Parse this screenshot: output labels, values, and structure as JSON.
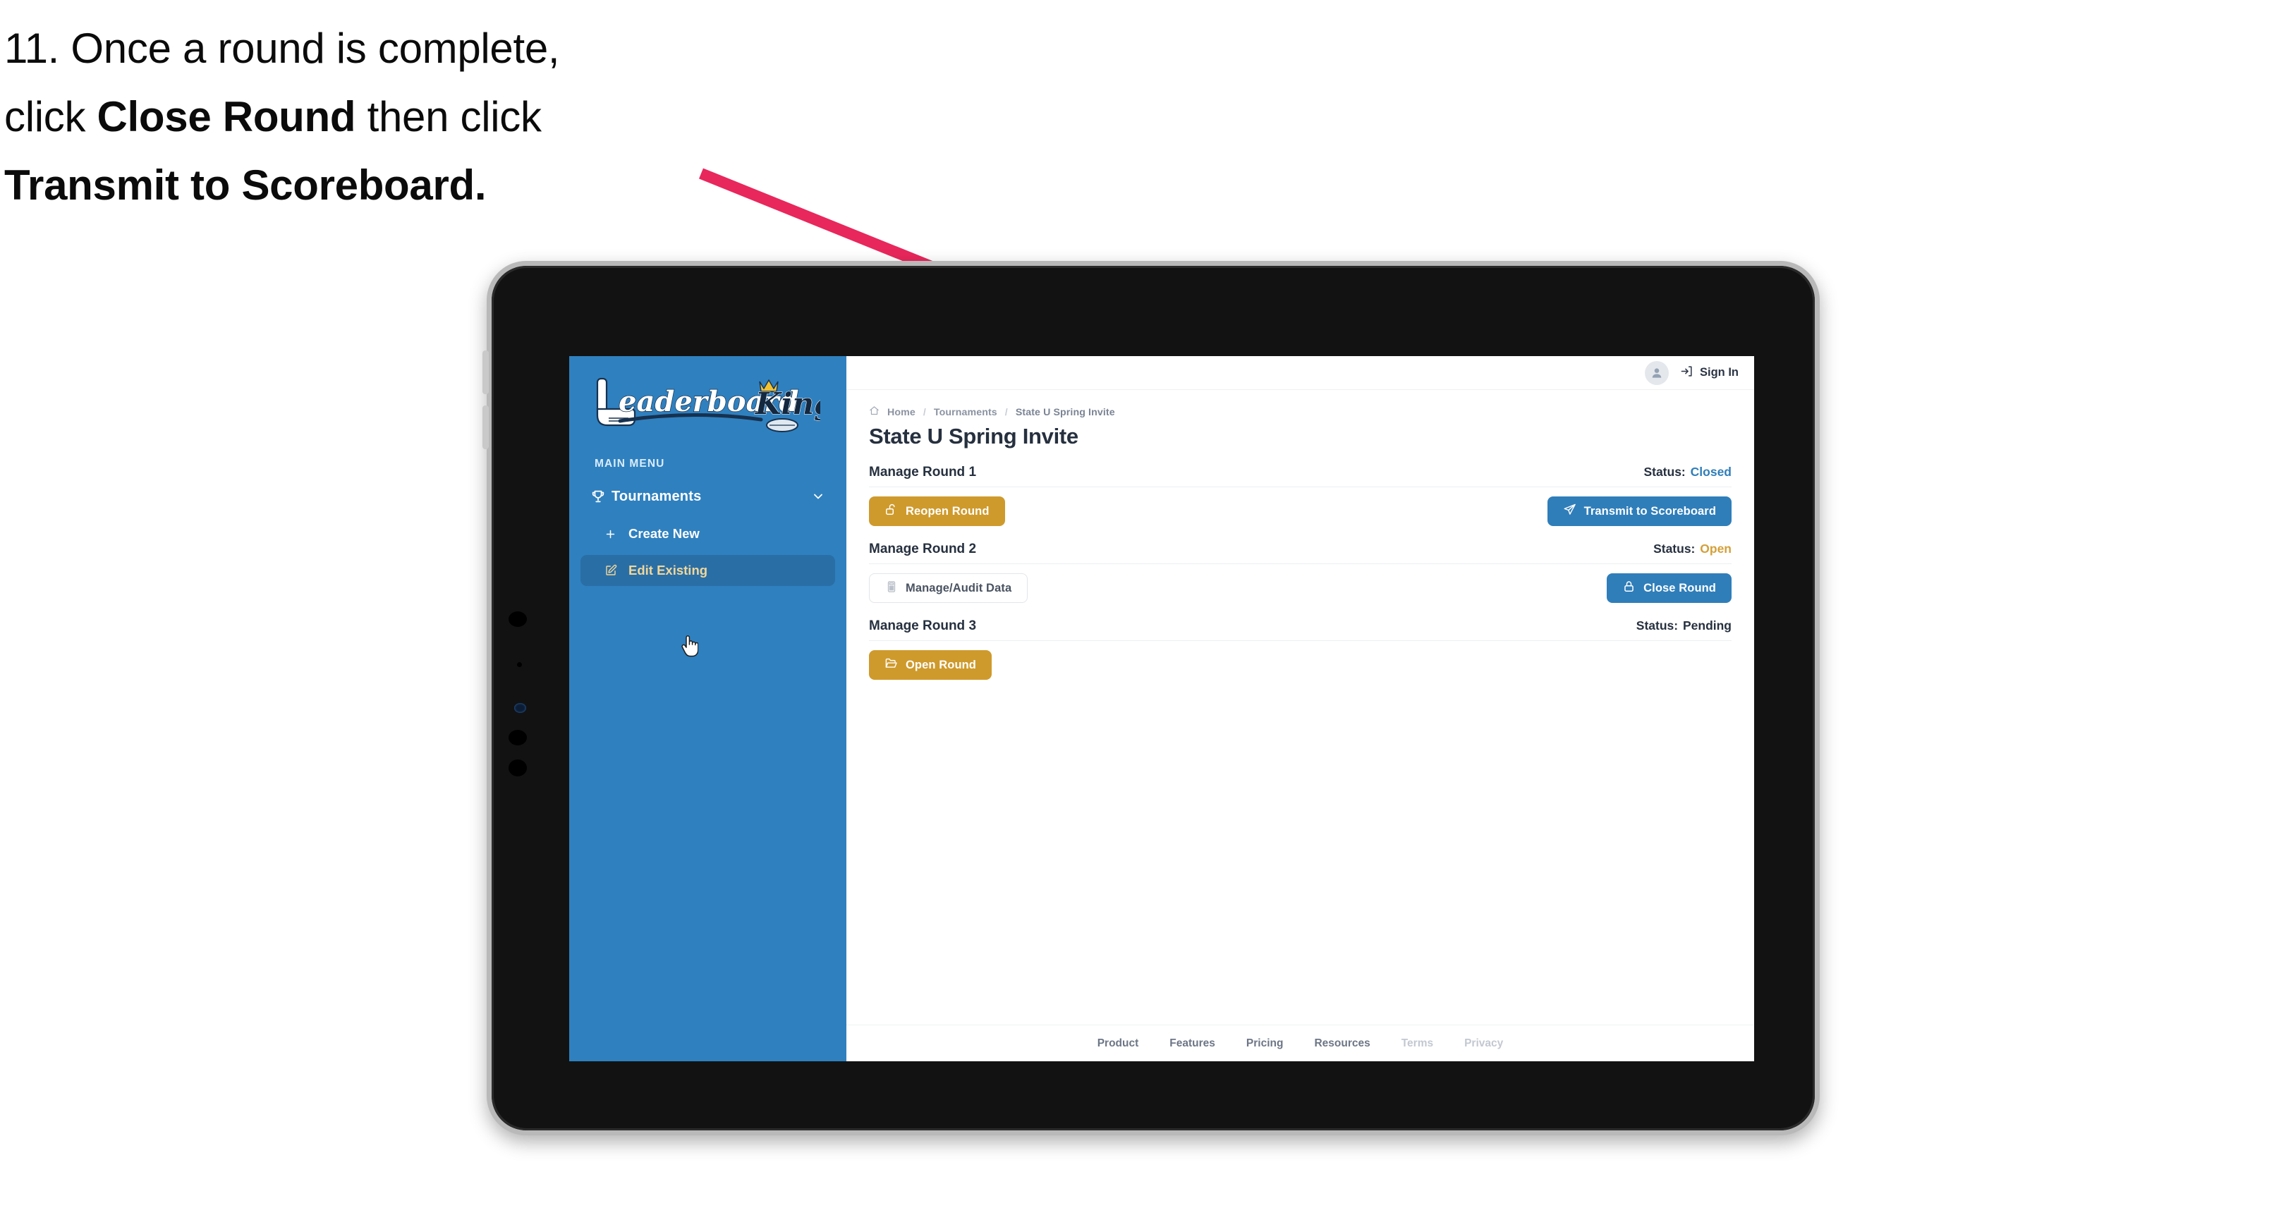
{
  "caption": {
    "line1_prefix": "11. Once a round is complete,",
    "line2_prefix": "click ",
    "line2_bold": "Close Round",
    "line2_suffix": " then click",
    "line3_bold": "Transmit to Scoreboard."
  },
  "annotation": {
    "arrow_color": "#e8275c",
    "name": "pointer-arrow"
  },
  "sidebar": {
    "logo_text_main": "Leaderboard",
    "logo_text_accent": "King",
    "menu_heading": "MAIN MENU",
    "items": [
      {
        "label": "Tournaments",
        "icon": "trophy-icon",
        "chevron": "chevron-down-icon",
        "active": false
      },
      {
        "label": "Create New",
        "icon": "plus-icon",
        "active": false
      },
      {
        "label": "Edit Existing",
        "icon": "edit-square-icon",
        "active": true
      }
    ]
  },
  "topbar": {
    "avatar_icon": "user-icon",
    "signin_icon": "sign-in-icon",
    "signin_label": "Sign In"
  },
  "breadcrumb": {
    "home_icon": "home-icon",
    "items": [
      "Home",
      "Tournaments",
      "State U Spring Invite"
    ],
    "separator": "/"
  },
  "page": {
    "title": "State U Spring Invite"
  },
  "rounds": [
    {
      "title": "Manage Round 1",
      "status_label": "Status:",
      "status_value": "Closed",
      "status_color": "#2f7eba",
      "left_button": {
        "label": "Reopen Round",
        "icon": "unlock-icon",
        "style": "gold"
      },
      "right_button": {
        "label": "Transmit to Scoreboard",
        "icon": "paper-plane-icon",
        "style": "blue"
      }
    },
    {
      "title": "Manage Round 2",
      "status_label": "Status:",
      "status_value": "Open",
      "status_color": "#d4a03a",
      "left_button": {
        "label": "Manage/Audit Data",
        "icon": "calculator-icon",
        "style": "ghost"
      },
      "right_button": {
        "label": "Close Round",
        "icon": "lock-icon",
        "style": "blue"
      }
    },
    {
      "title": "Manage Round 3",
      "status_label": "Status:",
      "status_value": "Pending",
      "status_color": "#26303f",
      "left_button": {
        "label": "Open Round",
        "icon": "folder-open-icon",
        "style": "gold"
      },
      "right_button": null
    }
  ],
  "footer": {
    "links": [
      {
        "label": "Product",
        "muted": false
      },
      {
        "label": "Features",
        "muted": false
      },
      {
        "label": "Pricing",
        "muted": false
      },
      {
        "label": "Resources",
        "muted": false
      },
      {
        "label": "Terms",
        "muted": true
      },
      {
        "label": "Privacy",
        "muted": true
      }
    ]
  },
  "colors": {
    "sidebar_blue": "#2f80bf",
    "sidebar_active": "#2a6ea6",
    "gold": "#cf9a2c",
    "blue": "#2f7eba",
    "accent_gold_text": "#f0d79a"
  }
}
